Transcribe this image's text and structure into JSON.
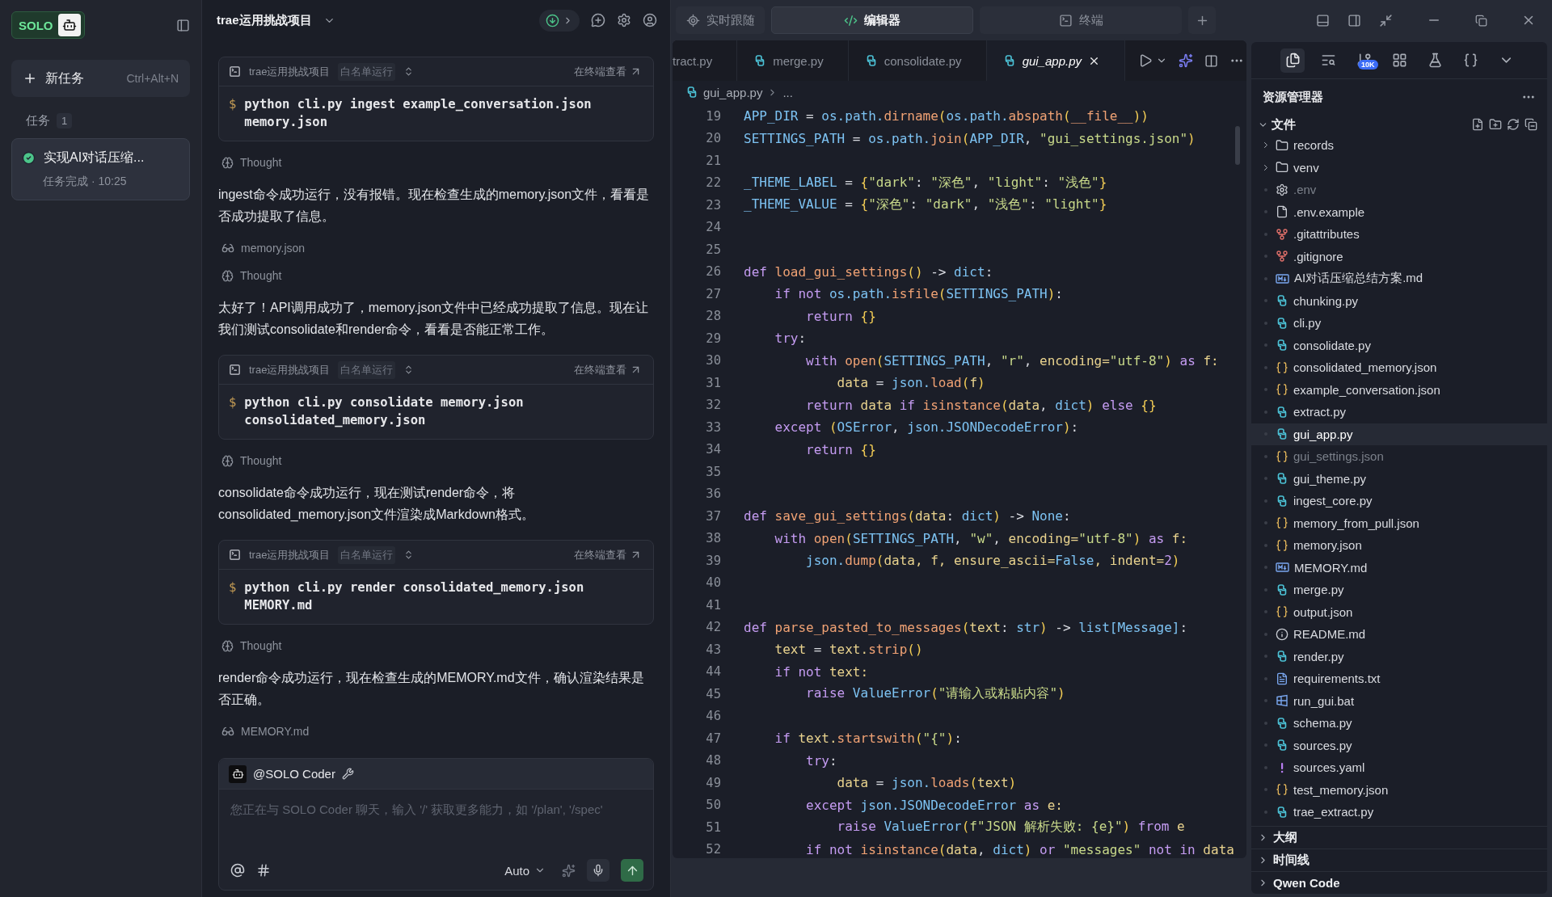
{
  "sidebar": {
    "logo": "SOLO",
    "new_task": {
      "label": "新任务",
      "shortcut": "Ctrl+Alt+N"
    },
    "tasks_label": "任务",
    "tasks_count": "1",
    "tasks": [
      {
        "title": "实现AI对话压缩...",
        "status": "任务完成 · 10:25",
        "done": true,
        "selected": true
      }
    ]
  },
  "chat": {
    "project": "trae运用挑战项目",
    "messages": [
      {
        "kind": "command",
        "project": "trae运用挑战项目",
        "mode": "白名单运行",
        "link": "在终端查看",
        "prompt": "$",
        "command": "python cli.py ingest example_conversation.json memory.json"
      },
      {
        "kind": "thought",
        "text": "Thought"
      },
      {
        "kind": "text",
        "text": "ingest命令成功运行，没有报错。现在检查生成的memory.json文件，看看是否成功提取了信息。"
      },
      {
        "kind": "file",
        "text": "memory.json"
      },
      {
        "kind": "thought",
        "text": "Thought"
      },
      {
        "kind": "text",
        "text": "太好了！API调用成功了，memory.json文件中已经成功提取了信息。现在让我们测试consolidate和render命令，看看是否能正常工作。"
      },
      {
        "kind": "command",
        "project": "trae运用挑战项目",
        "mode": "白名单运行",
        "link": "在终端查看",
        "prompt": "$",
        "command": "python cli.py consolidate memory.json consolidated_memory.json"
      },
      {
        "kind": "thought",
        "text": "Thought"
      },
      {
        "kind": "text",
        "text": "consolidate命令成功运行，现在测试render命令，将consolidated_memory.json文件渲染成Markdown格式。"
      },
      {
        "kind": "command",
        "project": "trae运用挑战项目",
        "mode": "白名单运行",
        "link": "在终端查看",
        "prompt": "$",
        "command": "python cli.py render consolidated_memory.json MEMORY.md"
      },
      {
        "kind": "thought",
        "text": "Thought"
      },
      {
        "kind": "text",
        "text": "render命令成功运行，现在检查生成的MEMORY.md文件，确认渲染结果是否正确。"
      },
      {
        "kind": "file",
        "text": "MEMORY.md"
      }
    ],
    "input": {
      "agent": "@SOLO Coder",
      "placeholder": "您正在与 SOLO Coder 聊天，输入 '/' 获取更多能力，如 '/plan', '/spec'",
      "model": "Auto"
    }
  },
  "view_tabs": [
    {
      "label": "实时跟随",
      "kind": "follow",
      "selected": false
    },
    {
      "label": "编辑器",
      "kind": "code",
      "selected": true
    },
    {
      "label": "终端",
      "kind": "terminal",
      "selected": false
    }
  ],
  "editor": {
    "tabs": [
      {
        "label": "tract.py",
        "cut": true,
        "selected": false
      },
      {
        "label": "merge.py",
        "cut": false,
        "selected": false
      },
      {
        "label": "consolidate.py",
        "cut": false,
        "selected": false
      },
      {
        "label": "gui_app.py",
        "cut": false,
        "selected": true
      }
    ],
    "breadcrumb": [
      "gui_app.py",
      "..."
    ],
    "lines": [
      {
        "number": "19",
        "tokens": [
          {
            "text": "APP_DIR",
            "kind": "id"
          },
          {
            "text": " = ",
            "kind": "op"
          },
          {
            "text": "os.path.",
            "kind": "id"
          },
          {
            "text": "dirname",
            "kind": "fn"
          },
          {
            "text": "(",
            "kind": "br"
          },
          {
            "text": "os.path.",
            "kind": "id"
          },
          {
            "text": "abspath",
            "kind": "fn"
          },
          {
            "text": "(",
            "kind": "br"
          },
          {
            "text": "__file__",
            "kind": "fn"
          },
          {
            "text": "))",
            "kind": "br"
          }
        ]
      },
      {
        "number": "20",
        "tokens": [
          {
            "text": "SETTINGS_PATH",
            "kind": "id"
          },
          {
            "text": " = ",
            "kind": "op"
          },
          {
            "text": "os.path.",
            "kind": "id"
          },
          {
            "text": "join",
            "kind": "fn"
          },
          {
            "text": "(",
            "kind": "br"
          },
          {
            "text": "APP_DIR",
            "kind": "id"
          },
          {
            "text": ", ",
            "kind": "op"
          },
          {
            "text": "\"gui_settings.json\"",
            "kind": "str"
          },
          {
            "text": ")",
            "kind": "br"
          }
        ]
      },
      {
        "number": "21"
      },
      {
        "number": "22",
        "tokens": [
          {
            "text": "_THEME_LABEL",
            "kind": "id"
          },
          {
            "text": " = ",
            "kind": "op"
          },
          {
            "text": "{",
            "kind": "br"
          },
          {
            "text": "\"dark\"",
            "kind": "str"
          },
          {
            "text": ": ",
            "kind": "op"
          },
          {
            "text": "\"深色\"",
            "kind": "str"
          },
          {
            "text": ", ",
            "kind": "op"
          },
          {
            "text": "\"light\"",
            "kind": "str"
          },
          {
            "text": ": ",
            "kind": "op"
          },
          {
            "text": "\"浅色\"",
            "kind": "str"
          },
          {
            "text": "}",
            "kind": "br"
          }
        ]
      },
      {
        "number": "23",
        "tokens": [
          {
            "text": "_THEME_VALUE",
            "kind": "id"
          },
          {
            "text": " = ",
            "kind": "op"
          },
          {
            "text": "{",
            "kind": "br"
          },
          {
            "text": "\"深色\"",
            "kind": "str"
          },
          {
            "text": ": ",
            "kind": "op"
          },
          {
            "text": "\"dark\"",
            "kind": "str"
          },
          {
            "text": ", ",
            "kind": "op"
          },
          {
            "text": "\"浅色\"",
            "kind": "str"
          },
          {
            "text": ": ",
            "kind": "op"
          },
          {
            "text": "\"light\"",
            "kind": "str"
          },
          {
            "text": "}",
            "kind": "br"
          }
        ]
      },
      {
        "number": "24"
      },
      {
        "number": "25"
      },
      {
        "number": "26",
        "tokens": [
          {
            "text": "def ",
            "kind": "kw"
          },
          {
            "text": "load_gui_settings",
            "kind": "fn"
          },
          {
            "text": "()",
            "kind": "br"
          },
          {
            "text": " -> ",
            "kind": "op"
          },
          {
            "text": "dict",
            "kind": "id"
          },
          {
            "text": ":",
            "kind": "op"
          }
        ]
      },
      {
        "number": "27",
        "tokens": [
          {
            "text": "    if not ",
            "kind": "kw"
          },
          {
            "text": "os.path.",
            "kind": "id"
          },
          {
            "text": "isfile",
            "kind": "fn"
          },
          {
            "text": "(",
            "kind": "br"
          },
          {
            "text": "SETTINGS_PATH",
            "kind": "id"
          },
          {
            "text": ")",
            "kind": "br"
          },
          {
            "text": ":",
            "kind": "op"
          }
        ]
      },
      {
        "number": "28",
        "tokens": [
          {
            "text": "        return ",
            "kind": "kw"
          },
          {
            "text": "{}",
            "kind": "br"
          }
        ]
      },
      {
        "number": "29",
        "tokens": [
          {
            "text": "    try",
            "kind": "kw"
          },
          {
            "text": ":",
            "kind": "op"
          }
        ]
      },
      {
        "number": "30",
        "tokens": [
          {
            "text": "        with ",
            "kind": "kw"
          },
          {
            "text": "open",
            "kind": "fn"
          },
          {
            "text": "(",
            "kind": "br"
          },
          {
            "text": "SETTINGS_PATH",
            "kind": "id"
          },
          {
            "text": ", ",
            "kind": "op"
          },
          {
            "text": "\"r\"",
            "kind": "str"
          },
          {
            "text": ", ",
            "kind": "op"
          },
          {
            "text": "encoding=",
            "kind": "var"
          },
          {
            "text": "\"utf-8\"",
            "kind": "str"
          },
          {
            "text": ")",
            "kind": "br"
          },
          {
            "text": " as ",
            "kind": "kw"
          },
          {
            "text": "f:",
            "kind": "var"
          }
        ]
      },
      {
        "number": "31",
        "tokens": [
          {
            "text": "            data",
            "kind": "var"
          },
          {
            "text": " = ",
            "kind": "op"
          },
          {
            "text": "json.",
            "kind": "id"
          },
          {
            "text": "load",
            "kind": "fn"
          },
          {
            "text": "(",
            "kind": "br"
          },
          {
            "text": "f",
            "kind": "var"
          },
          {
            "text": ")",
            "kind": "br"
          }
        ]
      },
      {
        "number": "32",
        "tokens": [
          {
            "text": "        return ",
            "kind": "kw"
          },
          {
            "text": "data",
            "kind": "var"
          },
          {
            "text": " if ",
            "kind": "kw"
          },
          {
            "text": "isinstance",
            "kind": "fn"
          },
          {
            "text": "(",
            "kind": "br"
          },
          {
            "text": "data",
            "kind": "var"
          },
          {
            "text": ", ",
            "kind": "op"
          },
          {
            "text": "dict",
            "kind": "id"
          },
          {
            "text": ")",
            "kind": "br"
          },
          {
            "text": " else ",
            "kind": "kw"
          },
          {
            "text": "{}",
            "kind": "br"
          }
        ]
      },
      {
        "number": "33",
        "tokens": [
          {
            "text": "    except ",
            "kind": "kw"
          },
          {
            "text": "(",
            "kind": "br"
          },
          {
            "text": "OSError",
            "kind": "id"
          },
          {
            "text": ", ",
            "kind": "op"
          },
          {
            "text": "json.JSONDecodeError",
            "kind": "id"
          },
          {
            "text": ")",
            "kind": "br"
          },
          {
            "text": ":",
            "kind": "op"
          }
        ]
      },
      {
        "number": "34",
        "tokens": [
          {
            "text": "        return ",
            "kind": "kw"
          },
          {
            "text": "{}",
            "kind": "br"
          }
        ]
      },
      {
        "number": "35"
      },
      {
        "number": "36"
      },
      {
        "number": "37",
        "tokens": [
          {
            "text": "def ",
            "kind": "kw"
          },
          {
            "text": "save_gui_settings",
            "kind": "fn"
          },
          {
            "text": "(",
            "kind": "br"
          },
          {
            "text": "data",
            "kind": "var"
          },
          {
            "text": ": ",
            "kind": "op"
          },
          {
            "text": "dict",
            "kind": "id"
          },
          {
            "text": ")",
            "kind": "br"
          },
          {
            "text": " -> ",
            "kind": "op"
          },
          {
            "text": "None",
            "kind": "id"
          },
          {
            "text": ":",
            "kind": "op"
          }
        ]
      },
      {
        "number": "38",
        "tokens": [
          {
            "text": "    with ",
            "kind": "kw"
          },
          {
            "text": "open",
            "kind": "fn"
          },
          {
            "text": "(",
            "kind": "br"
          },
          {
            "text": "SETTINGS_PATH",
            "kind": "id"
          },
          {
            "text": ", ",
            "kind": "op"
          },
          {
            "text": "\"w\"",
            "kind": "str"
          },
          {
            "text": ", ",
            "kind": "op"
          },
          {
            "text": "encoding=",
            "kind": "var"
          },
          {
            "text": "\"utf-8\"",
            "kind": "str"
          },
          {
            "text": ")",
            "kind": "br"
          },
          {
            "text": " as ",
            "kind": "kw"
          },
          {
            "text": "f:",
            "kind": "var"
          }
        ]
      },
      {
        "number": "39",
        "tokens": [
          {
            "text": "        json.",
            "kind": "id"
          },
          {
            "text": "dump",
            "kind": "fn"
          },
          {
            "text": "(",
            "kind": "br"
          },
          {
            "text": "data, f, ensure_ascii=",
            "kind": "var"
          },
          {
            "text": "False",
            "kind": "id"
          },
          {
            "text": ", indent=",
            "kind": "var"
          },
          {
            "text": "2",
            "kind": "num"
          },
          {
            "text": ")",
            "kind": "br"
          }
        ]
      },
      {
        "number": "40"
      },
      {
        "number": "41"
      },
      {
        "number": "42",
        "tokens": [
          {
            "text": "def ",
            "kind": "kw"
          },
          {
            "text": "parse_pasted_to_messages",
            "kind": "fn"
          },
          {
            "text": "(",
            "kind": "br"
          },
          {
            "text": "text",
            "kind": "var"
          },
          {
            "text": ": ",
            "kind": "op"
          },
          {
            "text": "str",
            "kind": "id"
          },
          {
            "text": ")",
            "kind": "br"
          },
          {
            "text": " -> ",
            "kind": "op"
          },
          {
            "text": "list[Message]",
            "kind": "id"
          },
          {
            "text": ":",
            "kind": "op"
          }
        ]
      },
      {
        "number": "43",
        "tokens": [
          {
            "text": "    text",
            "kind": "var"
          },
          {
            "text": " = ",
            "kind": "op"
          },
          {
            "text": "text.",
            "kind": "var"
          },
          {
            "text": "strip",
            "kind": "fn"
          },
          {
            "text": "()",
            "kind": "br"
          }
        ]
      },
      {
        "number": "44",
        "tokens": [
          {
            "text": "    if not ",
            "kind": "kw"
          },
          {
            "text": "text:",
            "kind": "var"
          }
        ]
      },
      {
        "number": "45",
        "tokens": [
          {
            "text": "        raise ",
            "kind": "kw"
          },
          {
            "text": "ValueError",
            "kind": "id"
          },
          {
            "text": "(",
            "kind": "br"
          },
          {
            "text": "\"请输入或粘贴内容\"",
            "kind": "str"
          },
          {
            "text": ")",
            "kind": "br"
          }
        ]
      },
      {
        "number": "46"
      },
      {
        "number": "47",
        "tokens": [
          {
            "text": "    if ",
            "kind": "kw"
          },
          {
            "text": "text.",
            "kind": "var"
          },
          {
            "text": "startswith",
            "kind": "fn"
          },
          {
            "text": "(",
            "kind": "br"
          },
          {
            "text": "\"{\"",
            "kind": "str"
          },
          {
            "text": ")",
            "kind": "br"
          },
          {
            "text": ":",
            "kind": "op"
          }
        ]
      },
      {
        "number": "48",
        "tokens": [
          {
            "text": "        try",
            "kind": "kw"
          },
          {
            "text": ":",
            "kind": "op"
          }
        ]
      },
      {
        "number": "49",
        "tokens": [
          {
            "text": "            data",
            "kind": "var"
          },
          {
            "text": " = ",
            "kind": "op"
          },
          {
            "text": "json.",
            "kind": "id"
          },
          {
            "text": "loads",
            "kind": "fn"
          },
          {
            "text": "(",
            "kind": "br"
          },
          {
            "text": "text",
            "kind": "var"
          },
          {
            "text": ")",
            "kind": "br"
          }
        ]
      },
      {
        "number": "50",
        "tokens": [
          {
            "text": "        except ",
            "kind": "kw"
          },
          {
            "text": "json.JSONDecodeError",
            "kind": "id"
          },
          {
            "text": " as ",
            "kind": "kw"
          },
          {
            "text": "e:",
            "kind": "var"
          }
        ]
      },
      {
        "number": "51",
        "tokens": [
          {
            "text": "            raise ",
            "kind": "kw"
          },
          {
            "text": "ValueError",
            "kind": "id"
          },
          {
            "text": "(",
            "kind": "br"
          },
          {
            "text": "f\"JSON 解析失败: {e}\"",
            "kind": "str"
          },
          {
            "text": ")",
            "kind": "br"
          },
          {
            "text": " from ",
            "kind": "kw"
          },
          {
            "text": "e",
            "kind": "var"
          }
        ]
      },
      {
        "number": "52",
        "tokens": [
          {
            "text": "        if not ",
            "kind": "kw"
          },
          {
            "text": "isinstance",
            "kind": "fn"
          },
          {
            "text": "(",
            "kind": "br"
          },
          {
            "text": "data",
            "kind": "var"
          },
          {
            "text": ", ",
            "kind": "op"
          },
          {
            "text": "dict",
            "kind": "id"
          },
          {
            "text": ")",
            "kind": "br"
          },
          {
            "text": " or ",
            "kind": "kw"
          },
          {
            "text": "\"messages\"",
            "kind": "str"
          },
          {
            "text": " not in ",
            "kind": "kw"
          },
          {
            "text": "data",
            "kind": "var"
          }
        ]
      }
    ]
  },
  "explorer": {
    "badge": "10K",
    "title": "资源管理器",
    "section": "文件",
    "items": [
      {
        "name": "records",
        "kind": "folder",
        "ignored": false,
        "selected": false
      },
      {
        "name": "venv",
        "kind": "folder",
        "ignored": false,
        "selected": false
      },
      {
        "name": ".env",
        "kind": "config",
        "ignored": true,
        "selected": false
      },
      {
        "name": ".env.example",
        "kind": "file",
        "ignored": false,
        "selected": false
      },
      {
        "name": ".gitattributes",
        "kind": "git",
        "ignored": false,
        "selected": false
      },
      {
        "name": ".gitignore",
        "kind": "git",
        "ignored": false,
        "selected": false
      },
      {
        "name": "AI对话压缩总结方案.md",
        "kind": "markdown",
        "ignored": false,
        "selected": false
      },
      {
        "name": "chunking.py",
        "kind": "python",
        "ignored": false,
        "selected": false
      },
      {
        "name": "cli.py",
        "kind": "python",
        "ignored": false,
        "selected": false
      },
      {
        "name": "consolidate.py",
        "kind": "python",
        "ignored": false,
        "selected": false
      },
      {
        "name": "consolidated_memory.json",
        "kind": "json",
        "ignored": false,
        "selected": false
      },
      {
        "name": "example_conversation.json",
        "kind": "json",
        "ignored": false,
        "selected": false
      },
      {
        "name": "extract.py",
        "kind": "python",
        "ignored": false,
        "selected": false
      },
      {
        "name": "gui_app.py",
        "kind": "python",
        "ignored": false,
        "selected": true
      },
      {
        "name": "gui_settings.json",
        "kind": "json",
        "ignored": true,
        "selected": false
      },
      {
        "name": "gui_theme.py",
        "kind": "python",
        "ignored": false,
        "selected": false
      },
      {
        "name": "ingest_core.py",
        "kind": "python",
        "ignored": false,
        "selected": false
      },
      {
        "name": "memory_from_pull.json",
        "kind": "json",
        "ignored": false,
        "selected": false
      },
      {
        "name": "memory.json",
        "kind": "json",
        "ignored": false,
        "selected": false
      },
      {
        "name": "MEMORY.md",
        "kind": "markdown",
        "ignored": false,
        "selected": false
      },
      {
        "name": "merge.py",
        "kind": "python",
        "ignored": false,
        "selected": false
      },
      {
        "name": "output.json",
        "kind": "json",
        "ignored": false,
        "selected": false
      },
      {
        "name": "README.md",
        "kind": "info",
        "ignored": false,
        "selected": false
      },
      {
        "name": "render.py",
        "kind": "python",
        "ignored": false,
        "selected": false
      },
      {
        "name": "requirements.txt",
        "kind": "text",
        "ignored": false,
        "selected": false
      },
      {
        "name": "run_gui.bat",
        "kind": "windows",
        "ignored": false,
        "selected": false
      },
      {
        "name": "schema.py",
        "kind": "python",
        "ignored": false,
        "selected": false
      },
      {
        "name": "sources.py",
        "kind": "python",
        "ignored": false,
        "selected": false
      },
      {
        "name": "sources.yaml",
        "kind": "yaml",
        "ignored": false,
        "selected": false
      },
      {
        "name": "test_memory.json",
        "kind": "json",
        "ignored": false,
        "selected": false
      },
      {
        "name": "trae_extract.py",
        "kind": "python",
        "ignored": false,
        "selected": false
      }
    ],
    "sections": [
      {
        "label": "大纲",
        "expanded": false
      },
      {
        "label": "时间线",
        "expanded": false
      },
      {
        "label": "Qwen Code",
        "expanded": false
      }
    ]
  }
}
